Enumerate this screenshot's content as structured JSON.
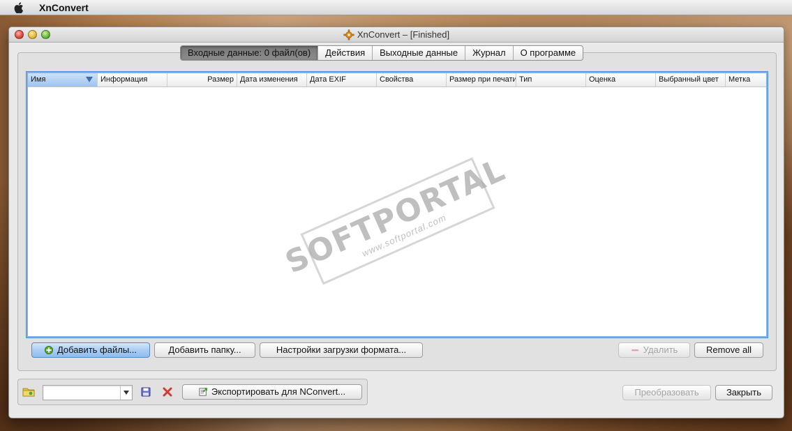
{
  "menubar": {
    "app_name": "XnConvert"
  },
  "window": {
    "title": "XnConvert – [Finished]"
  },
  "tabs": [
    {
      "label": "Входные данные: 0 файл(ов)",
      "active": true
    },
    {
      "label": "Действия",
      "active": false
    },
    {
      "label": "Выходные данные",
      "active": false
    },
    {
      "label": "Журнал",
      "active": false
    },
    {
      "label": "О программе",
      "active": false
    }
  ],
  "table": {
    "columns": [
      {
        "label": "Имя",
        "sorted": true
      },
      {
        "label": "Информация"
      },
      {
        "label": "Размер"
      },
      {
        "label": "Дата изменения"
      },
      {
        "label": "Дата EXIF"
      },
      {
        "label": "Свойства"
      },
      {
        "label": "Размер при печати"
      },
      {
        "label": "Тип"
      },
      {
        "label": "Оценка"
      },
      {
        "label": "Выбранный цвет"
      },
      {
        "label": "Метка"
      }
    ],
    "rows": []
  },
  "watermark": {
    "main": "SOFTPORTAL",
    "sub": "www.softportal.com"
  },
  "input_buttons": {
    "add_files": "Добавить файлы...",
    "add_folder": "Добавить папку...",
    "format_settings": "Настройки загрузки формата...",
    "delete": "Удалить",
    "remove_all": "Remove all"
  },
  "bottom": {
    "preset_value": "",
    "export_label": "Экспортировать для NConvert...",
    "convert_label": "Преобразовать",
    "close_label": "Закрыть"
  },
  "colors": {
    "accent": "#7fb0e4",
    "primary_button": "#a9cdf4",
    "delete_red": "#d43a2f"
  }
}
